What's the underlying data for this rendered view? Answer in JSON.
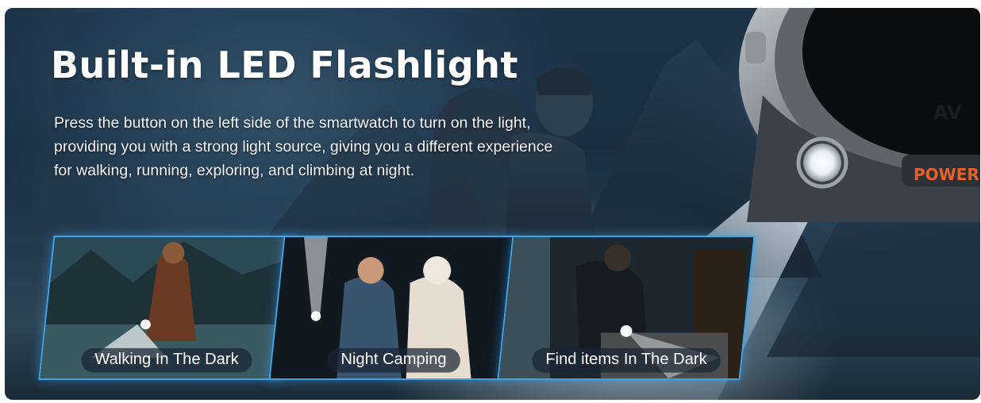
{
  "banner": {
    "title": "Built-in LED Flashlight",
    "description": "Press the button on the left side of the smartwatch to turn on the light, providing you with a strong light source, giving you a different experience for walking, running, exploring, and climbing at night.",
    "watch_markings": [
      "AV",
      "POWER"
    ],
    "accent_color": "#3fa3e6",
    "watch_accent_color": "#e8602a"
  },
  "scenes": [
    {
      "label": "Walking In The Dark"
    },
    {
      "label": "Night Camping"
    },
    {
      "label": "Find items In The Dark"
    }
  ]
}
